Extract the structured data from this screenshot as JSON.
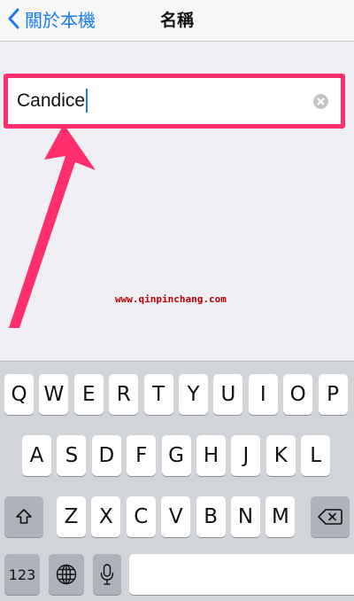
{
  "nav": {
    "back_label": "關於本機",
    "title": "名稱"
  },
  "name_field": {
    "value": "Candice"
  },
  "watermark": "www.qinpinchang.com",
  "accent_color": "#1a7cf0",
  "highlight_color": "#ff2f6e",
  "keyboard": {
    "row1": [
      "Q",
      "W",
      "E",
      "R",
      "T",
      "Y",
      "U",
      "I",
      "O",
      "P"
    ],
    "row2": [
      "A",
      "S",
      "D",
      "F",
      "G",
      "H",
      "J",
      "K",
      "L"
    ],
    "row3": [
      "Z",
      "X",
      "C",
      "V",
      "B",
      "N",
      "M"
    ],
    "numbers_label": "123",
    "shift_icon": "shift-icon",
    "delete_icon": "delete-icon",
    "globe_icon": "globe-icon",
    "mic_icon": "microphone-icon"
  }
}
